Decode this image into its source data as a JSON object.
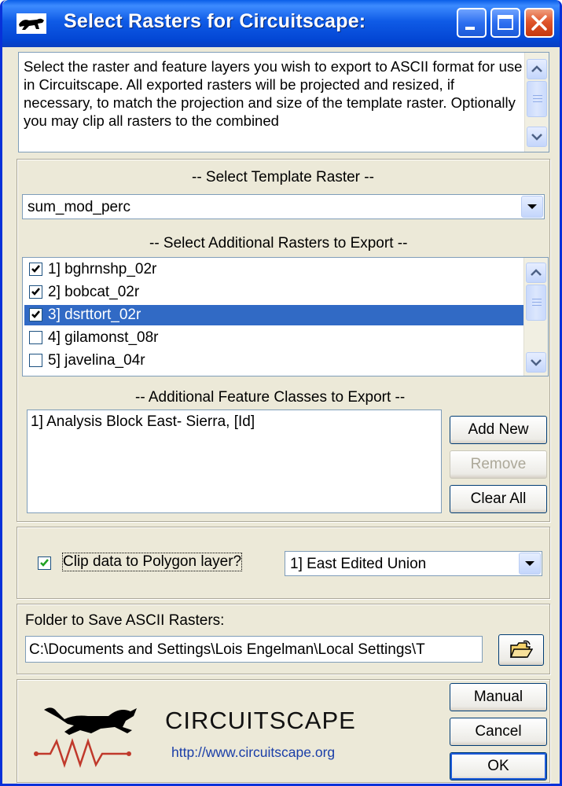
{
  "window": {
    "title": "Select Rasters for Circuitscape:"
  },
  "intro": {
    "text": "Select the raster and feature layers you wish to export to ASCII format for use in Circuitscape. All exported rasters will be projected and resized, if necessary, to match the projection and size of the template raster.  Optionally you may clip all rasters to the combined"
  },
  "template": {
    "heading": "-- Select Template Raster --",
    "value": "sum_mod_perc"
  },
  "rasters": {
    "heading": "-- Select Additional Rasters to Export --",
    "items": [
      {
        "label": "1] bghrnshp_02r",
        "checked": true
      },
      {
        "label": "2] bobcat_02r",
        "checked": true
      },
      {
        "label": "3] dsrttort_02r",
        "checked": true
      },
      {
        "label": "4] gilamonst_08r",
        "checked": false
      },
      {
        "label": "5] javelina_04r",
        "checked": false
      }
    ]
  },
  "features": {
    "heading": "-- Additional Feature Classes to Export --",
    "items": [
      "1] Analysis Block East- Sierra, [Id]"
    ],
    "add_label": "Add New",
    "remove_label": "Remove",
    "clear_label": "Clear All"
  },
  "clip": {
    "label": "Clip data to Polygon layer?",
    "checked": true,
    "layer": "1] East Edited Union"
  },
  "folder": {
    "label": "Folder to Save ASCII Rasters:",
    "path": "C:\\Documents and Settings\\Lois Engelman\\Local Settings\\T"
  },
  "footer": {
    "brand": "CIRCUITSCAPE",
    "url": "http://www.circuitscape.org",
    "manual_label": "Manual",
    "cancel_label": "Cancel",
    "ok_label": "OK"
  },
  "colors": {
    "titlebar": "#0a5ee8",
    "selection": "#316ac5",
    "face": "#ece9d8",
    "logo_red": "#c0392b"
  }
}
